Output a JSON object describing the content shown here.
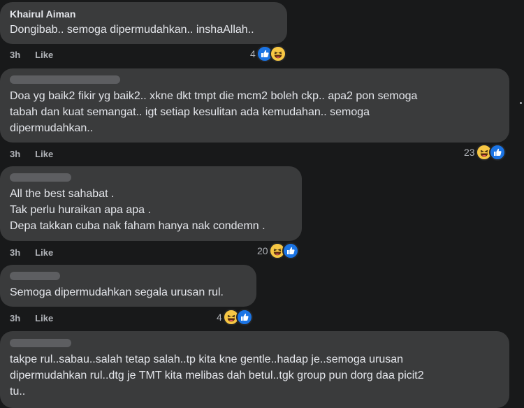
{
  "comments": [
    {
      "author": "Khairul Aiman",
      "text": "Dongibab.. semoga dipermudahkan.. inshaAllah..",
      "time": "3h",
      "like_label": "Like",
      "reaction_count": "4",
      "reactions": [
        "like-icon",
        "haha-icon"
      ]
    },
    {
      "author": "",
      "text": "Doa yg baik2 fikir yg baik2.. xkne dkt tmpt die mcm2 boleh ckp.. apa2 pon semoga\ntabah dan kuat semangat.. igt setiap kesulitan ada kemudahan.. semoga\ndipermudahkan..",
      "time": "3h",
      "like_label": "Like",
      "reaction_count": "23",
      "reactions": [
        "haha-icon",
        "like-icon"
      ]
    },
    {
      "author": "",
      "text": "All the best sahabat .\nTak perlu huraikan apa apa .\nDepa takkan cuba nak faham hanya nak condemn .",
      "time": "3h",
      "like_label": "Like",
      "reaction_count": "20",
      "reactions": [
        "haha-icon",
        "like-icon"
      ]
    },
    {
      "author": "",
      "text": "Semoga dipermudahkan segala urusan rul.",
      "time": "3h",
      "like_label": "Like",
      "reaction_count": "4",
      "reactions": [
        "haha-icon",
        "like-icon"
      ]
    },
    {
      "author": "",
      "text": "takpe rul..sabau..salah tetap salah..tp kita kne gentle..hadap je..semoga urusan\ndipermudahkan rul..dtg je TMT kita melibas dah betul..tgk group pun dorg daa picit2\ntu..",
      "time": "",
      "like_label": "",
      "reaction_count": "",
      "reactions": []
    }
  ],
  "colors": {
    "background": "#18191a",
    "bubble": "#3a3b3c",
    "text": "#e4e6eb",
    "meta": "#b0b3b8",
    "like_blue": "#1b74e4",
    "haha_yellow": "#f7c744"
  }
}
